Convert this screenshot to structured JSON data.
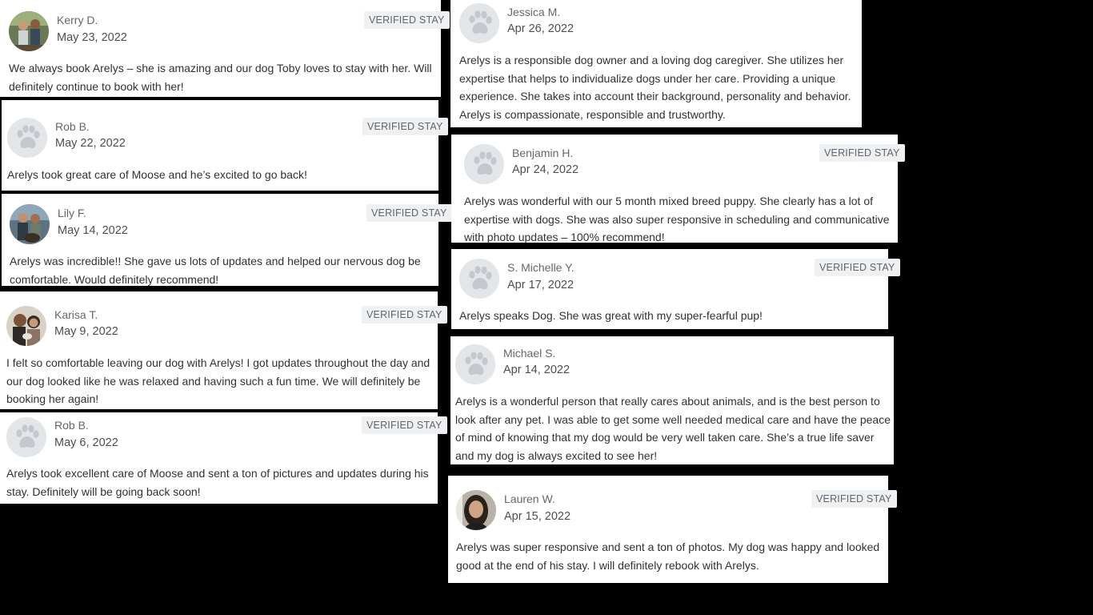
{
  "badge_label": "VERIFIED STAY",
  "reviews": [
    {
      "name": "Kerry D.",
      "date": "May 23, 2022",
      "avatar": "photo",
      "text": "We always book Arelys – she is amazing and our dog Toby loves to stay with her. Will definitely continue to book with her!"
    },
    {
      "name": "Rob B.",
      "date": "May 22, 2022",
      "avatar": "paw-icon",
      "text": "Arelys took great care of Moose and he’s excited to go back!"
    },
    {
      "name": "Lily F.",
      "date": "May 14, 2022",
      "avatar": "photo",
      "text": "Arelys was incredible!! She gave us lots of updates and helped our nervous dog be comfortable. Would definitely recommend!"
    },
    {
      "name": "Karisa T.",
      "date": "May 9, 2022",
      "avatar": "photo",
      "text": "I felt so comfortable leaving our dog with Arelys! I got updates throughout the day and our dog looked like he was relaxed and having such a fun time. We will definitely be booking her again!"
    },
    {
      "name": "Rob B.",
      "date": "May 6, 2022",
      "avatar": "paw-icon",
      "text": "Arelys took excellent care of Moose and sent a ton of pictures and updates during his stay. Definitely will be going back soon!"
    },
    {
      "name": "Jessica M.",
      "date": "Apr 26, 2022",
      "avatar": "paw-icon",
      "text": "Arelys is a responsible dog owner and a loving dog caregiver. She utilizes her expertise that helps to individualize dogs under her care. Providing a unique experience. She takes into account their background, personality and behavior. Arelys is compassionate, responsible and trustworthy."
    },
    {
      "name": "Benjamin H.",
      "date": "Apr 24, 2022",
      "avatar": "paw-icon",
      "text": "Arelys was wonderful with our 5 month mixed breed puppy. She clearly has a lot of expertise with dogs. She was also super responsive in scheduling and communicative with photo updates – 100% recommend!"
    },
    {
      "name": "S. Michelle Y.",
      "date": "Apr 17, 2022",
      "avatar": "paw-icon",
      "text": "Arelys speaks Dog. She was great with my super-fearful pup!"
    },
    {
      "name": "Michael S.",
      "date": "Apr 14, 2022",
      "avatar": "paw-icon",
      "text": "Arelys is a wonderful person that really cares about animals, and is the best person to look after any pet. I was able to get some well needed medical care and have the peace of mind of knowing that my dog would be very well taken care. She’s a true life saver and my dog is always excited to see her!"
    },
    {
      "name": "Lauren W.",
      "date": "Apr 15, 2022",
      "avatar": "photo",
      "text": "Arelys was super responsive and sent a ton of photos. My dog was happy and looked good at the end of his stay. I will definitely rebook with Arelys."
    }
  ]
}
